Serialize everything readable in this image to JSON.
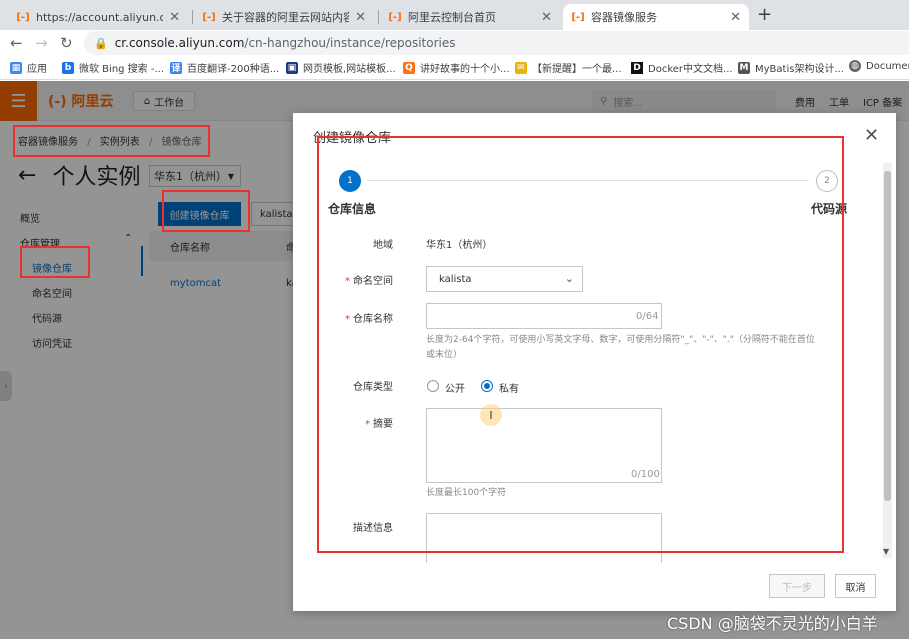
{
  "browser": {
    "tabs": [
      {
        "title": "https://account.aliyun.com/lo"
      },
      {
        "title": "关于容器的阿里云网站内容、产品"
      },
      {
        "title": "阿里云控制台首页"
      },
      {
        "title": "容器镜像服务"
      }
    ],
    "url_host": "cr.console.aliyun.com",
    "url_path": "/cn-hangzhou/instance/repositories",
    "bookmarks": [
      {
        "label": "应用"
      },
      {
        "label": "微软 Bing 搜索 -..."
      },
      {
        "label": "百度翻译-200种语..."
      },
      {
        "label": "网页模板,网站模板..."
      },
      {
        "label": "讲好故事的十个小..."
      },
      {
        "label": "【新提醒】一个最..."
      },
      {
        "label": "Docker中文文档..."
      },
      {
        "label": "MyBatis架构设计..."
      },
      {
        "label": "Documen"
      }
    ]
  },
  "console": {
    "logo": "阿里云",
    "workbench": "工作台",
    "search_placeholder": "搜索...",
    "top_links": [
      "费用",
      "工单",
      "ICP 备案"
    ],
    "breadcrumb": [
      "容器镜像服务",
      "实例列表",
      "镜像仓库"
    ],
    "page_title": "个人实例",
    "region": "华东1（杭州）",
    "sidebar": {
      "overview": "概览",
      "repo_mgmt": "仓库管理",
      "items": [
        "镜像仓库",
        "命名空间",
        "代码源",
        "访问凭证"
      ]
    },
    "create_button": "创建镜像仓库",
    "namespace_filter": "kalista",
    "table_header": "仓库名称",
    "table_header2": "命",
    "row_name": "mytomcat",
    "row_ns": "ka"
  },
  "modal": {
    "title": "创建镜像仓库",
    "steps": [
      {
        "num": "1",
        "label": "仓库信息"
      },
      {
        "num": "2",
        "label": "代码源"
      }
    ],
    "region_label": "地域",
    "region_value": "华东1（杭州）",
    "namespace_label": "命名空间",
    "namespace_value": "kalista",
    "repo_name_label": "仓库名称",
    "repo_name_counter": "0/64",
    "repo_name_hint": "长度为2-64个字符，可使用小写英文字母、数字，可使用分隔符\"_\"、\"-\"、\".\"（分隔符不能在首位或末位）",
    "repo_type_label": "仓库类型",
    "repo_type_options": [
      "公开",
      "私有"
    ],
    "repo_type_selected": "私有",
    "summary_label": "摘要",
    "summary_counter": "0/100",
    "summary_hint": "长度最长100个字符",
    "description_label": "描述信息",
    "next_button": "下一步",
    "cancel_button": "取消"
  },
  "watermark": "CSDN @脑袋不灵光的小白羊",
  "colors": {
    "accent": "#0070cc",
    "brand": "#ff6a00",
    "annotation": "#e8322f"
  }
}
